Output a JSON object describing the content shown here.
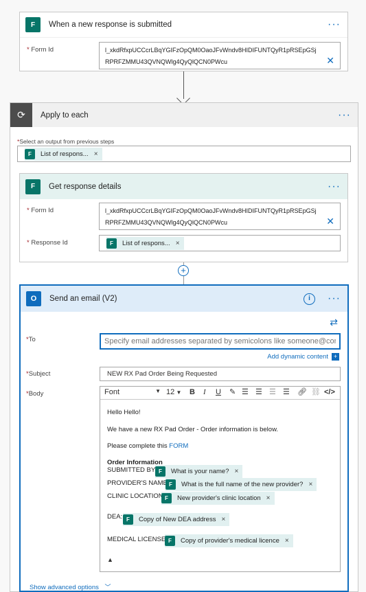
{
  "trigger": {
    "title": "When a new response is submitted",
    "form_id_label": "Form Id",
    "form_id_line1": "l_xkdRfxpUCCcrLBqYGIFzOpQM0OaoJFvWndv8HIDIFUNTQyR1pRSEpGSj",
    "form_id_line2": "RPRFZMMU43QVNQWlg4QyQlQCN0PWcu"
  },
  "apply": {
    "title": "Apply to each",
    "select_label": "Select an output from previous steps",
    "token": "List of respons..."
  },
  "details": {
    "title": "Get response details",
    "form_id_label": "Form Id",
    "form_id_line1": "l_xkdRfxpUCCcrLBqYGIFzOpQM0OaoJFvWndv8HIDIFUNTQyR1pRSEpGSj",
    "form_id_line2": "RPRFZMMU43QVNQWlg4QyQlQCN0PWcu",
    "response_id_label": "Response Id",
    "response_token": "List of respons..."
  },
  "email": {
    "title": "Send an email (V2)",
    "to_label": "To",
    "to_placeholder": "Specify email addresses separated by semicolons like someone@contoso.com",
    "add_dynamic": "Add dynamic content",
    "subject_label": "Subject",
    "subject_value": "NEW RX Pad Order Being Requested",
    "body_label": "Body",
    "font_name": "Font",
    "font_size": "12",
    "body": {
      "greeting": "Hello Hello!",
      "line1": "We have a new RX Pad Order - Order information is below.",
      "line2_prefix": "Please complete this ",
      "line2_link": "FORM",
      "heading": "Order Information",
      "submitted_label": "SUBMITTED BY:",
      "submitted_token": "What is your name?",
      "provider_label": "PROVIDER'S NAME:",
      "provider_token": "What is the full name of the new provider?",
      "clinic_label": "CLINIC LOCATION:",
      "clinic_token": "New provider's clinic location",
      "dea_label": "DEA:",
      "dea_token": "Copy of New DEA address",
      "license_label": "MEDICAL LICENSE:",
      "license_token": "Copy of provider's medical licence"
    },
    "advanced": "Show advanced options"
  },
  "colors": {
    "accent": "#0f6cbd",
    "forms": "#077568",
    "token_bg": "#e1f0f0"
  }
}
